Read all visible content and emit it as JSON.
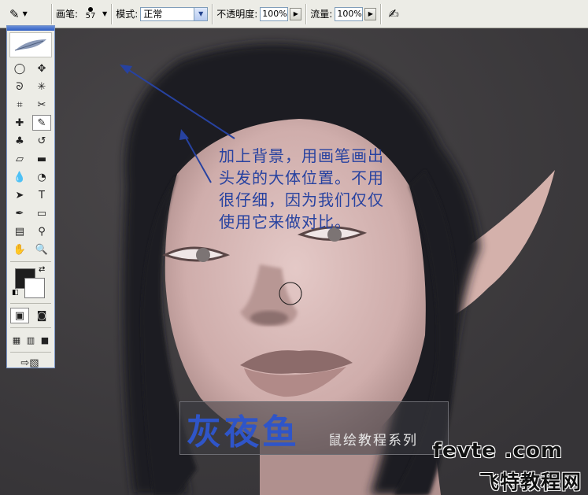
{
  "options_bar": {
    "brush_label": "画笔:",
    "brush_size": "57",
    "mode_label": "模式:",
    "mode_value": "正常",
    "opacity_label": "不透明度:",
    "opacity_value": "100%",
    "flow_label": "流量:",
    "flow_value": "100%"
  },
  "toolbox": {
    "tools": [
      {
        "name": "marquee-tool",
        "glyph": "◯"
      },
      {
        "name": "move-tool",
        "glyph": "✥"
      },
      {
        "name": "lasso-tool",
        "glyph": "ᘐ"
      },
      {
        "name": "magic-wand-tool",
        "glyph": "✳"
      },
      {
        "name": "crop-tool",
        "glyph": "⌗"
      },
      {
        "name": "slice-tool",
        "glyph": "✂"
      },
      {
        "name": "healing-brush-tool",
        "glyph": "✚"
      },
      {
        "name": "brush-tool",
        "glyph": "✎"
      },
      {
        "name": "clone-stamp-tool",
        "glyph": "♣"
      },
      {
        "name": "history-brush-tool",
        "glyph": "↺"
      },
      {
        "name": "eraser-tool",
        "glyph": "▱"
      },
      {
        "name": "gradient-tool",
        "glyph": "▬"
      },
      {
        "name": "blur-tool",
        "glyph": "💧"
      },
      {
        "name": "dodge-tool",
        "glyph": "◔"
      },
      {
        "name": "path-selection-tool",
        "glyph": "➤"
      },
      {
        "name": "type-tool",
        "glyph": "T"
      },
      {
        "name": "pen-tool",
        "glyph": "✒"
      },
      {
        "name": "shape-tool",
        "glyph": "▭"
      },
      {
        "name": "notes-tool",
        "glyph": "▤"
      },
      {
        "name": "eyedropper-tool",
        "glyph": "⚲"
      },
      {
        "name": "hand-tool",
        "glyph": "✋"
      },
      {
        "name": "zoom-tool",
        "glyph": "🔍"
      }
    ],
    "foreground_color": "#1e1e1e",
    "background_color": "#ffffff"
  },
  "annotation": {
    "lines": [
      "加上背景，用画笔画出",
      "头发的大体位置。不用",
      "很仔细，因为我们仅仅",
      "使用它来做对比。"
    ]
  },
  "signature": {
    "title": "灰夜鱼",
    "subtitle": "鼠绘教程系列"
  },
  "watermark": {
    "line1": "fevte .com",
    "line2": "飞特教程网"
  },
  "colors": {
    "canvas_bg": "#3f3d40",
    "hair": "#1f1f21",
    "skin": "#d7b7b4",
    "annotation": "#2742a0"
  }
}
